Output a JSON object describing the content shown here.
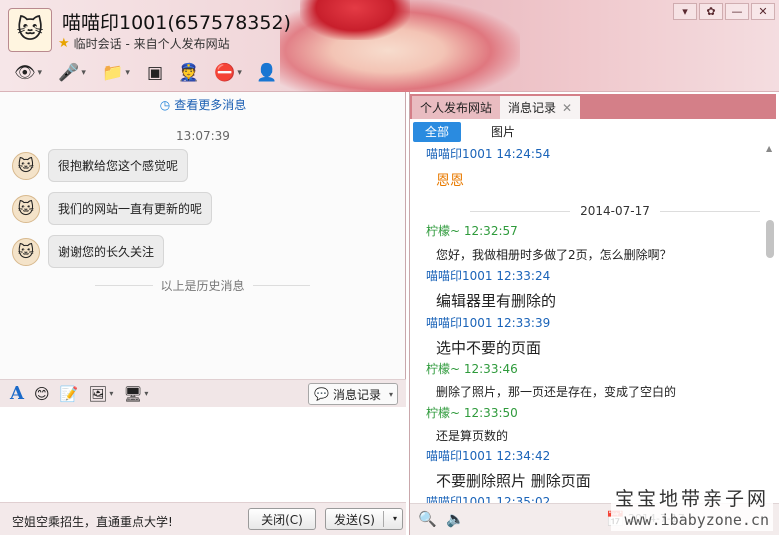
{
  "header": {
    "title": "喵喵印1001(657578352)",
    "subtitle": "临时会话 - 来自个人发布网站",
    "window_buttons": [
      "▾",
      "✕",
      "—",
      "✕"
    ]
  },
  "left": {
    "more_messages": "查看更多消息",
    "time": "13:07:39",
    "messages": [
      "很抱歉给您这个感觉呢",
      "我们的网站一直有更新的呢",
      "谢谢您的长久关注"
    ],
    "history_divider": "以上是历史消息",
    "message_record_button": "消息记录",
    "ad_text": "空姐空乘招生，直通重点大学!",
    "close_button": "关闭(C)",
    "send_button": "发送(S)"
  },
  "right": {
    "tabs": [
      {
        "label": "个人发布网站"
      },
      {
        "label": "消息记录"
      }
    ],
    "subtabs": [
      "全部",
      "图片"
    ],
    "history": {
      "top_partial": "喵喵印1001 14:24:54",
      "top_text": "恩恩",
      "date": "2014-07-17",
      "entries": [
        {
          "sender": "柠檬~ 12:32:57",
          "text": "您好，我做相册时多做了2页，怎么删除啊？"
        },
        {
          "sender": "喵喵印1001 12:33:24",
          "text": "编辑器里有删除的"
        },
        {
          "sender": "喵喵印1001 12:33:39",
          "text": "选中不要的页面"
        },
        {
          "sender": "柠檬~ 12:33:46",
          "text": "删除了照片，那一页还是存在，变成了空白的"
        },
        {
          "sender": "柠檬~ 12:33:50",
          "text": "还是算页数的"
        },
        {
          "sender": "喵喵印1001 12:34:42",
          "text": "不要删除照片 删除页面"
        },
        {
          "sender": "喵喵印1001 12:35:02",
          "text": ""
        }
      ]
    },
    "footer_date": "2014-7-17"
  },
  "watermark": {
    "line1": "宝宝地带亲子网",
    "line2": "www.ibabyzone.cn"
  },
  "colors": {
    "accent_blue": "#2a8be0",
    "sender_blue": "#1a63b8",
    "sender_green": "#2e9a3b",
    "tab_bar": "#d47f88"
  }
}
